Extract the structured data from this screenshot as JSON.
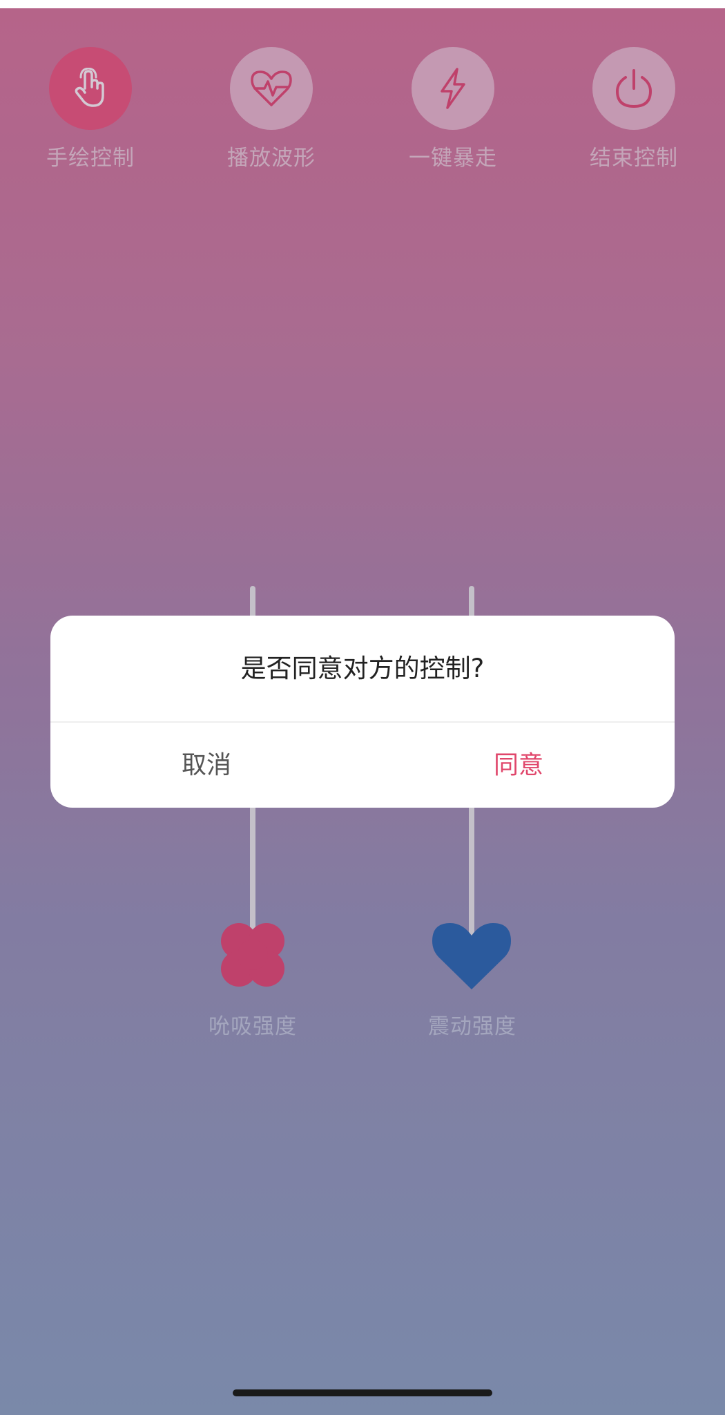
{
  "toolbar": {
    "items": [
      {
        "label": "手绘控制",
        "icon": "hand-pointer-icon"
      },
      {
        "label": "播放波形",
        "icon": "heartbeat-icon"
      },
      {
        "label": "一键暴走",
        "icon": "lightning-icon"
      },
      {
        "label": "结束控制",
        "icon": "power-icon"
      }
    ]
  },
  "sliders": {
    "suction": {
      "label": "吮吸强度",
      "icon": "flower-icon",
      "color": "#d2426f"
    },
    "vibration": {
      "label": "震动强度",
      "icon": "heart-icon",
      "color": "#2a5fa8"
    }
  },
  "dialog": {
    "message": "是否同意对方的控制?",
    "cancel_label": "取消",
    "confirm_label": "同意",
    "confirm_color": "#e0466b"
  },
  "colors": {
    "accent": "#db4f79",
    "gradient_top": "#c76a91",
    "gradient_bottom": "#8394b6"
  }
}
